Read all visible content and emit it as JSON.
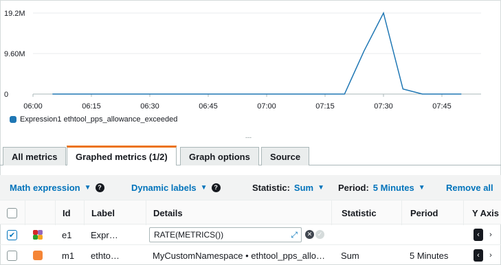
{
  "chart_data": {
    "type": "line",
    "x": [
      "06:05",
      "06:10",
      "06:15",
      "06:20",
      "06:25",
      "06:30",
      "06:35",
      "06:40",
      "06:45",
      "06:50",
      "06:55",
      "07:00",
      "07:05",
      "07:10",
      "07:15",
      "07:20",
      "07:25",
      "07:30",
      "07:35",
      "07:40",
      "07:45",
      "07:50"
    ],
    "series": [
      {
        "name": "Expression1 ethtool_pps_allowance_exceeded",
        "color": "#1f77b4",
        "values": [
          0,
          0,
          0,
          0,
          0,
          0,
          0,
          0,
          0,
          0,
          0,
          0,
          0,
          0,
          0,
          0,
          10200000,
          19200000,
          1200000,
          0,
          0,
          0
        ]
      }
    ],
    "xticks": [
      "06:00",
      "06:15",
      "06:30",
      "06:45",
      "07:00",
      "07:15",
      "07:30",
      "07:45"
    ],
    "yticks": [
      "0",
      "9.60M",
      "19.2M"
    ],
    "yvalues": [
      0,
      9600000,
      19200000
    ],
    "ylim": [
      0,
      19200000
    ],
    "grid": true,
    "legend_position": "bottom-left"
  },
  "legend": {
    "label": "Expression1 ethtool_pps_allowance_exceeded"
  },
  "resize_handle": "---",
  "tabs": [
    {
      "label": "All metrics",
      "active": false
    },
    {
      "label": "Graphed metrics (1/2)",
      "active": true
    },
    {
      "label": "Graph options",
      "active": false
    },
    {
      "label": "Source",
      "active": false
    }
  ],
  "toolbar": {
    "math_expression": "Math expression",
    "dynamic_labels": "Dynamic labels",
    "statistic_label": "Statistic:",
    "statistic_value": "Sum",
    "period_label": "Period:",
    "period_value": "5 Minutes",
    "remove_all": "Remove all"
  },
  "table": {
    "headers": {
      "id": "Id",
      "label": "Label",
      "details": "Details",
      "statistic": "Statistic",
      "period": "Period",
      "yaxis": "Y Axis"
    },
    "rows": [
      {
        "checked": true,
        "color": "#multicolor",
        "id": "e1",
        "label": "Expr…",
        "details": "RATE(METRICS())",
        "statistic": "",
        "period": ""
      },
      {
        "checked": false,
        "color": "#f58536",
        "id": "m1",
        "label": "ethto…",
        "details": "MyCustomNamespace • ethtool_pps_allo…",
        "statistic": "Sum",
        "period": "5 Minutes"
      }
    ]
  },
  "colors": {
    "accent": "#0073bb",
    "tab_active": "#ec7211",
    "series": "#1f77b4",
    "metric_orange": "#f58536"
  }
}
